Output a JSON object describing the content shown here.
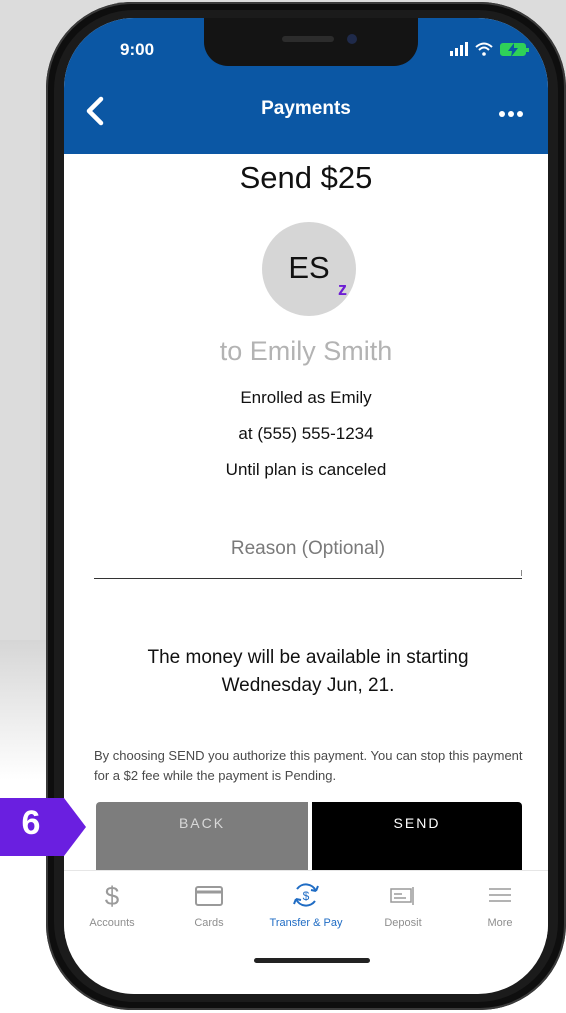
{
  "status_bar": {
    "time": "9:00"
  },
  "nav": {
    "title": "Payments"
  },
  "payment": {
    "title": "Send $25",
    "avatar_initials": "ES",
    "recipient_line": "to Emily Smith",
    "enrolled": "Enrolled as Emily",
    "phone": "at (555) 555-1234",
    "frequency": "Until plan is canceled"
  },
  "reason": {
    "placeholder": "Reason (Optional)"
  },
  "availability": "The money will be available in starting Wednesday Jun, 21.",
  "disclaimer": "By choosing SEND you authorize this payment. You can stop this payment for a $2 fee while the payment is Pending.",
  "buttons": {
    "back": "BACK",
    "send": "SEND"
  },
  "tabs": [
    {
      "label": "Accounts",
      "icon": "dollar-icon"
    },
    {
      "label": "Cards",
      "icon": "card-icon"
    },
    {
      "label": "Transfer & Pay",
      "icon": "transfer-icon"
    },
    {
      "label": "Deposit",
      "icon": "check-deposit-icon"
    },
    {
      "label": "More",
      "icon": "menu-icon"
    }
  ],
  "callout": {
    "number": "6",
    "color": "#6a1fe0"
  },
  "colors": {
    "header": "#0b57a4",
    "accent": "#1f6cc4",
    "zelle": "#6d1ed4"
  }
}
